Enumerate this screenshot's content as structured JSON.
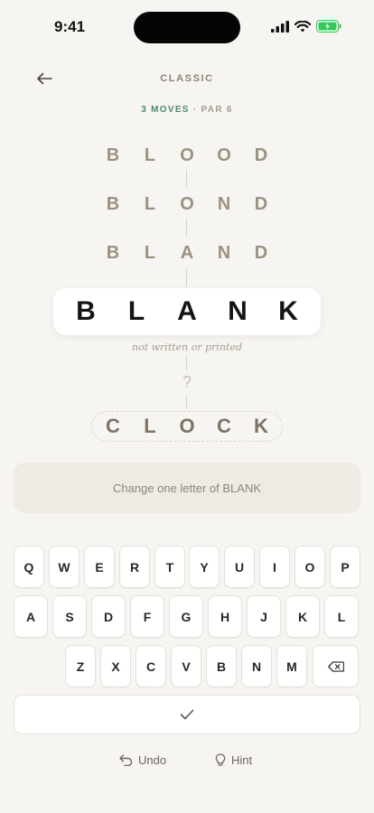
{
  "status_bar": {
    "time": "9:41"
  },
  "header": {
    "mode": "CLASSIC",
    "moves_label": "3 MOVES",
    "par_label": "· PAR 6"
  },
  "ladder": {
    "history": [
      [
        "B",
        "L",
        "O",
        "O",
        "D"
      ],
      [
        "B",
        "L",
        "O",
        "N",
        "D"
      ],
      [
        "B",
        "L",
        "A",
        "N",
        "D"
      ]
    ],
    "current": [
      "B",
      "L",
      "A",
      "N",
      "K"
    ],
    "definition": "not written or printed",
    "unknown": "?",
    "target": [
      "C",
      "L",
      "O",
      "C",
      "K"
    ]
  },
  "hint_banner": "Change one letter of BLANK",
  "keyboard": {
    "row1": [
      "Q",
      "W",
      "E",
      "R",
      "T",
      "Y",
      "U",
      "I",
      "O",
      "P"
    ],
    "row2": [
      "A",
      "S",
      "D",
      "F",
      "G",
      "H",
      "J",
      "K",
      "L"
    ],
    "row3": [
      "Z",
      "X",
      "C",
      "V",
      "B",
      "N",
      "M"
    ]
  },
  "footer": {
    "undo": "Undo",
    "hint": "Hint"
  },
  "icons": {
    "back": "arrow-left-icon",
    "backspace": "backspace-icon",
    "submit": "checkmark-icon",
    "undo": "undo-icon",
    "hint": "lightbulb-icon"
  },
  "colors": {
    "background": "#f7f5f1",
    "accent_green": "#4f8a70",
    "ladder_letters": "#9c9181",
    "battery": "#34c759"
  }
}
